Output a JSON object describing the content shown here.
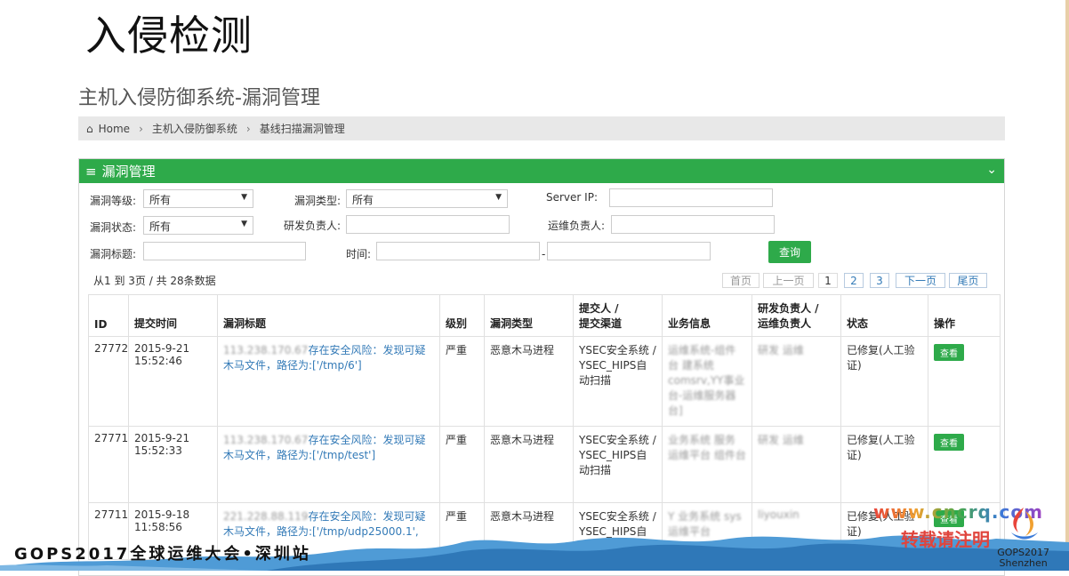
{
  "slide": {
    "title": "入侵检测"
  },
  "page": {
    "title": "主机入侵防御系统-漏洞管理"
  },
  "breadcrumb": {
    "home": "Home",
    "level1": "主机入侵防御系统",
    "level2": "基线扫描漏洞管理"
  },
  "panel": {
    "title": "漏洞管理"
  },
  "filters": {
    "level_label": "漏洞等级:",
    "level_value": "所有",
    "type_label": "漏洞类型:",
    "type_value": "所有",
    "server_ip_label": "Server IP:",
    "server_ip_value": "",
    "status_label": "漏洞状态:",
    "status_value": "所有",
    "dev_owner_label": "研发负责人:",
    "dev_owner_value": "",
    "ops_owner_label": "运维负责人:",
    "ops_owner_value": "",
    "title_label": "漏洞标题:",
    "title_value": "",
    "time_label": "时间:",
    "time_sep": "-",
    "search_button": "查询"
  },
  "summary": "从1 到 3页 / 共 28条数据",
  "pagination": {
    "first": "首页",
    "prev": "上一页",
    "pages": [
      "1",
      "2",
      "3"
    ],
    "next": "下一页",
    "last": "尾页"
  },
  "table": {
    "headers": {
      "id": "ID",
      "time": "提交时间",
      "title": "漏洞标题",
      "level": "级别",
      "type": "漏洞类型",
      "submitter_line1": "提交人 /",
      "submitter_line2": "提交渠道",
      "business": "业务信息",
      "owner_line1": "研发负责人 /",
      "owner_line2": "运维负责人",
      "status": "状态",
      "action": "操作"
    },
    "rows": [
      {
        "id": "27772",
        "date": "2015-9-21",
        "time": "15:52:46",
        "title_prefix": "113.238.170.67",
        "title": "存在安全风险：发现可疑木马文件，路径为:['/tmp/6']",
        "level": "严重",
        "type": "恶意木马进程",
        "submitter": "YSEC安全系统 / YSEC_HIPS自动扫描",
        "business": "运维系统-组件台 建系统 comsrv,YY事业 台-运维服务器 台]",
        "owners": "研发 运维",
        "status": "已修复(人工验证)",
        "action": "查看"
      },
      {
        "id": "27771",
        "date": "2015-9-21",
        "time": "15:52:33",
        "title_prefix": "113.238.170.67",
        "title": "存在安全风险：发现可疑木马文件，路径为:['/tmp/test']",
        "level": "严重",
        "type": "恶意木马进程",
        "submitter": "YSEC安全系统 / YSEC_HIPS自动扫描",
        "business": "业务系统 服务 运维平台 组件台",
        "owners": "研发 运维",
        "status": "已修复(人工验证)",
        "action": "查看"
      },
      {
        "id": "27711",
        "date": "2015-9-18",
        "time": "11:58:56",
        "title_prefix": "221.228.88.119",
        "title": "存在安全风险：发现可疑木马文件，路径为:['/tmp/udp25000.1',",
        "level": "严重",
        "type": "恶意木马进程",
        "submitter": "YSEC安全系统 / YSEC_HIPS自动扫描",
        "business": "Y 业务系统 sys 运维平台",
        "owners": "liyouxin",
        "status": "已修复(人工验证)",
        "action": "查看"
      }
    ]
  },
  "footer": {
    "event": "GOPS2017全球运维大会•深圳站",
    "brand_line1": "GOPS2017",
    "brand_line2": "Shenzhen"
  },
  "watermark": {
    "url": "www.cncrq.com",
    "note": "转载请注明"
  },
  "colors": {
    "accent_green": "#2eaa4a",
    "link_blue": "#337ab7"
  }
}
